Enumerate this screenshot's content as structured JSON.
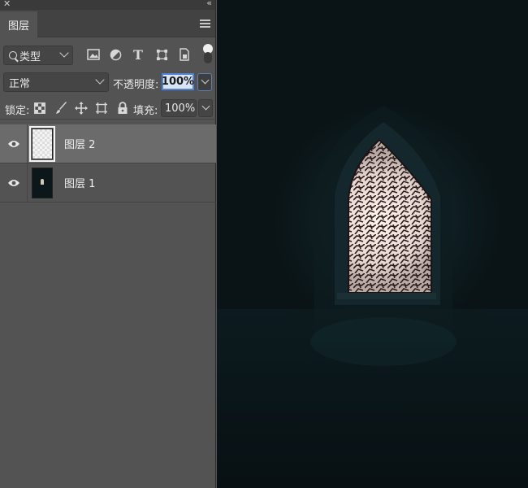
{
  "panel": {
    "close_glyph": "✕",
    "collapse_glyph": "‹‹",
    "tab_label": "图层",
    "menu_icon": "hamburger-menu-icon"
  },
  "filter": {
    "kind_label": "类型",
    "icons": [
      "image-filter-icon",
      "adjustment-filter-icon",
      "type-filter-icon",
      "shape-filter-icon",
      "smart-object-filter-icon"
    ]
  },
  "blend": {
    "mode": "正常",
    "opacity_label": "不透明度:",
    "opacity_value": "100%"
  },
  "lock": {
    "label": "锁定:",
    "icons": [
      "lock-transparent-icon",
      "lock-image-icon",
      "lock-position-icon",
      "lock-artboard-icon",
      "lock-all-icon"
    ],
    "fill_label": "填充:",
    "fill_value": "100%"
  },
  "layers": [
    {
      "name": "图层 2",
      "selected": true,
      "thumbnail": "transparent"
    },
    {
      "name": "图层 1",
      "selected": false,
      "thumbnail": "image"
    }
  ],
  "colors": {
    "panel_bg": "#535353",
    "selected_row": "#6b6b6b",
    "focus_blue": "#4e83d6"
  }
}
